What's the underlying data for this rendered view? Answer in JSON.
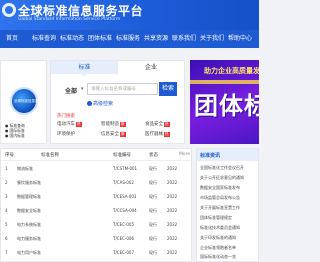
{
  "header": {
    "title": "全球标准信息服务平台",
    "subtitle": "Global Standard Information Service Platform"
  },
  "nav": [
    "首页",
    "标准查询",
    "标准动态",
    "团体标准",
    "标准服务",
    "共享资源",
    "联系我们",
    "关于我们",
    "帮助中心"
  ],
  "profile": {
    "avatar_text": "全球标准信息服务平台",
    "lines": [
      "● 标准查询",
      "● 国际标准",
      "● 国内标准"
    ]
  },
  "search": {
    "tabs": [
      "标准",
      "企业"
    ],
    "scope": "全部",
    "placeholder": "请输入标准名称或编号",
    "button": "检索",
    "hint": "高级检索",
    "hot_label": "热门搜索",
    "hot": [
      {
        "label": "电动汽车",
        "badge": "热"
      },
      {
        "label": "智能制造",
        "badge": "新"
      },
      {
        "label": "食品安全",
        "badge": "热"
      },
      {
        "label": "环境保护",
        "badge": ""
      },
      {
        "label": "信息安全",
        "badge": "新"
      },
      {
        "label": "医疗器械",
        "badge": "热"
      }
    ]
  },
  "banner": {
    "top": "助力企业高质量发展",
    "big": "团体标"
  },
  "table": {
    "headers": [
      "序号",
      "标准名称",
      "标准编号",
      "状态",
      "发布"
    ],
    "more": "More",
    "rows": [
      [
        "1",
        "物流标准",
        "T/CSTM-001",
        "现行",
        "2022"
      ],
      [
        "2",
        "餐饮服务标准",
        "T/CAS-002",
        "现行",
        "2022"
      ],
      [
        "3",
        "数据管理标准",
        "T/CESA-003",
        "现行",
        "2022"
      ],
      [
        "4",
        "数据安全标准",
        "T/CCSA-004",
        "现行",
        "2022"
      ],
      [
        "5",
        "电力系统标准",
        "T/CEC-005",
        "现行",
        "2022"
      ],
      [
        "6",
        "电力服务标准",
        "T/CEC-006",
        "现行",
        "2022"
      ],
      [
        "7",
        "电力用户标准",
        "T/CEC-007",
        "现行",
        "2022"
      ]
    ]
  },
  "news": {
    "title": "标准资讯",
    "items": [
      "全国标准化工作会议召开",
      "关于公开征求意见的通知",
      "数据安全国家标准发布",
      "市场监管总局发布公告",
      "关于开展标准宣贯工作",
      "团体标准管理规定",
      "标准化技术委员会通知",
      "关于印发标准的通知",
      "企业标准领跑者名单",
      "国际标准化动态一览"
    ]
  }
}
